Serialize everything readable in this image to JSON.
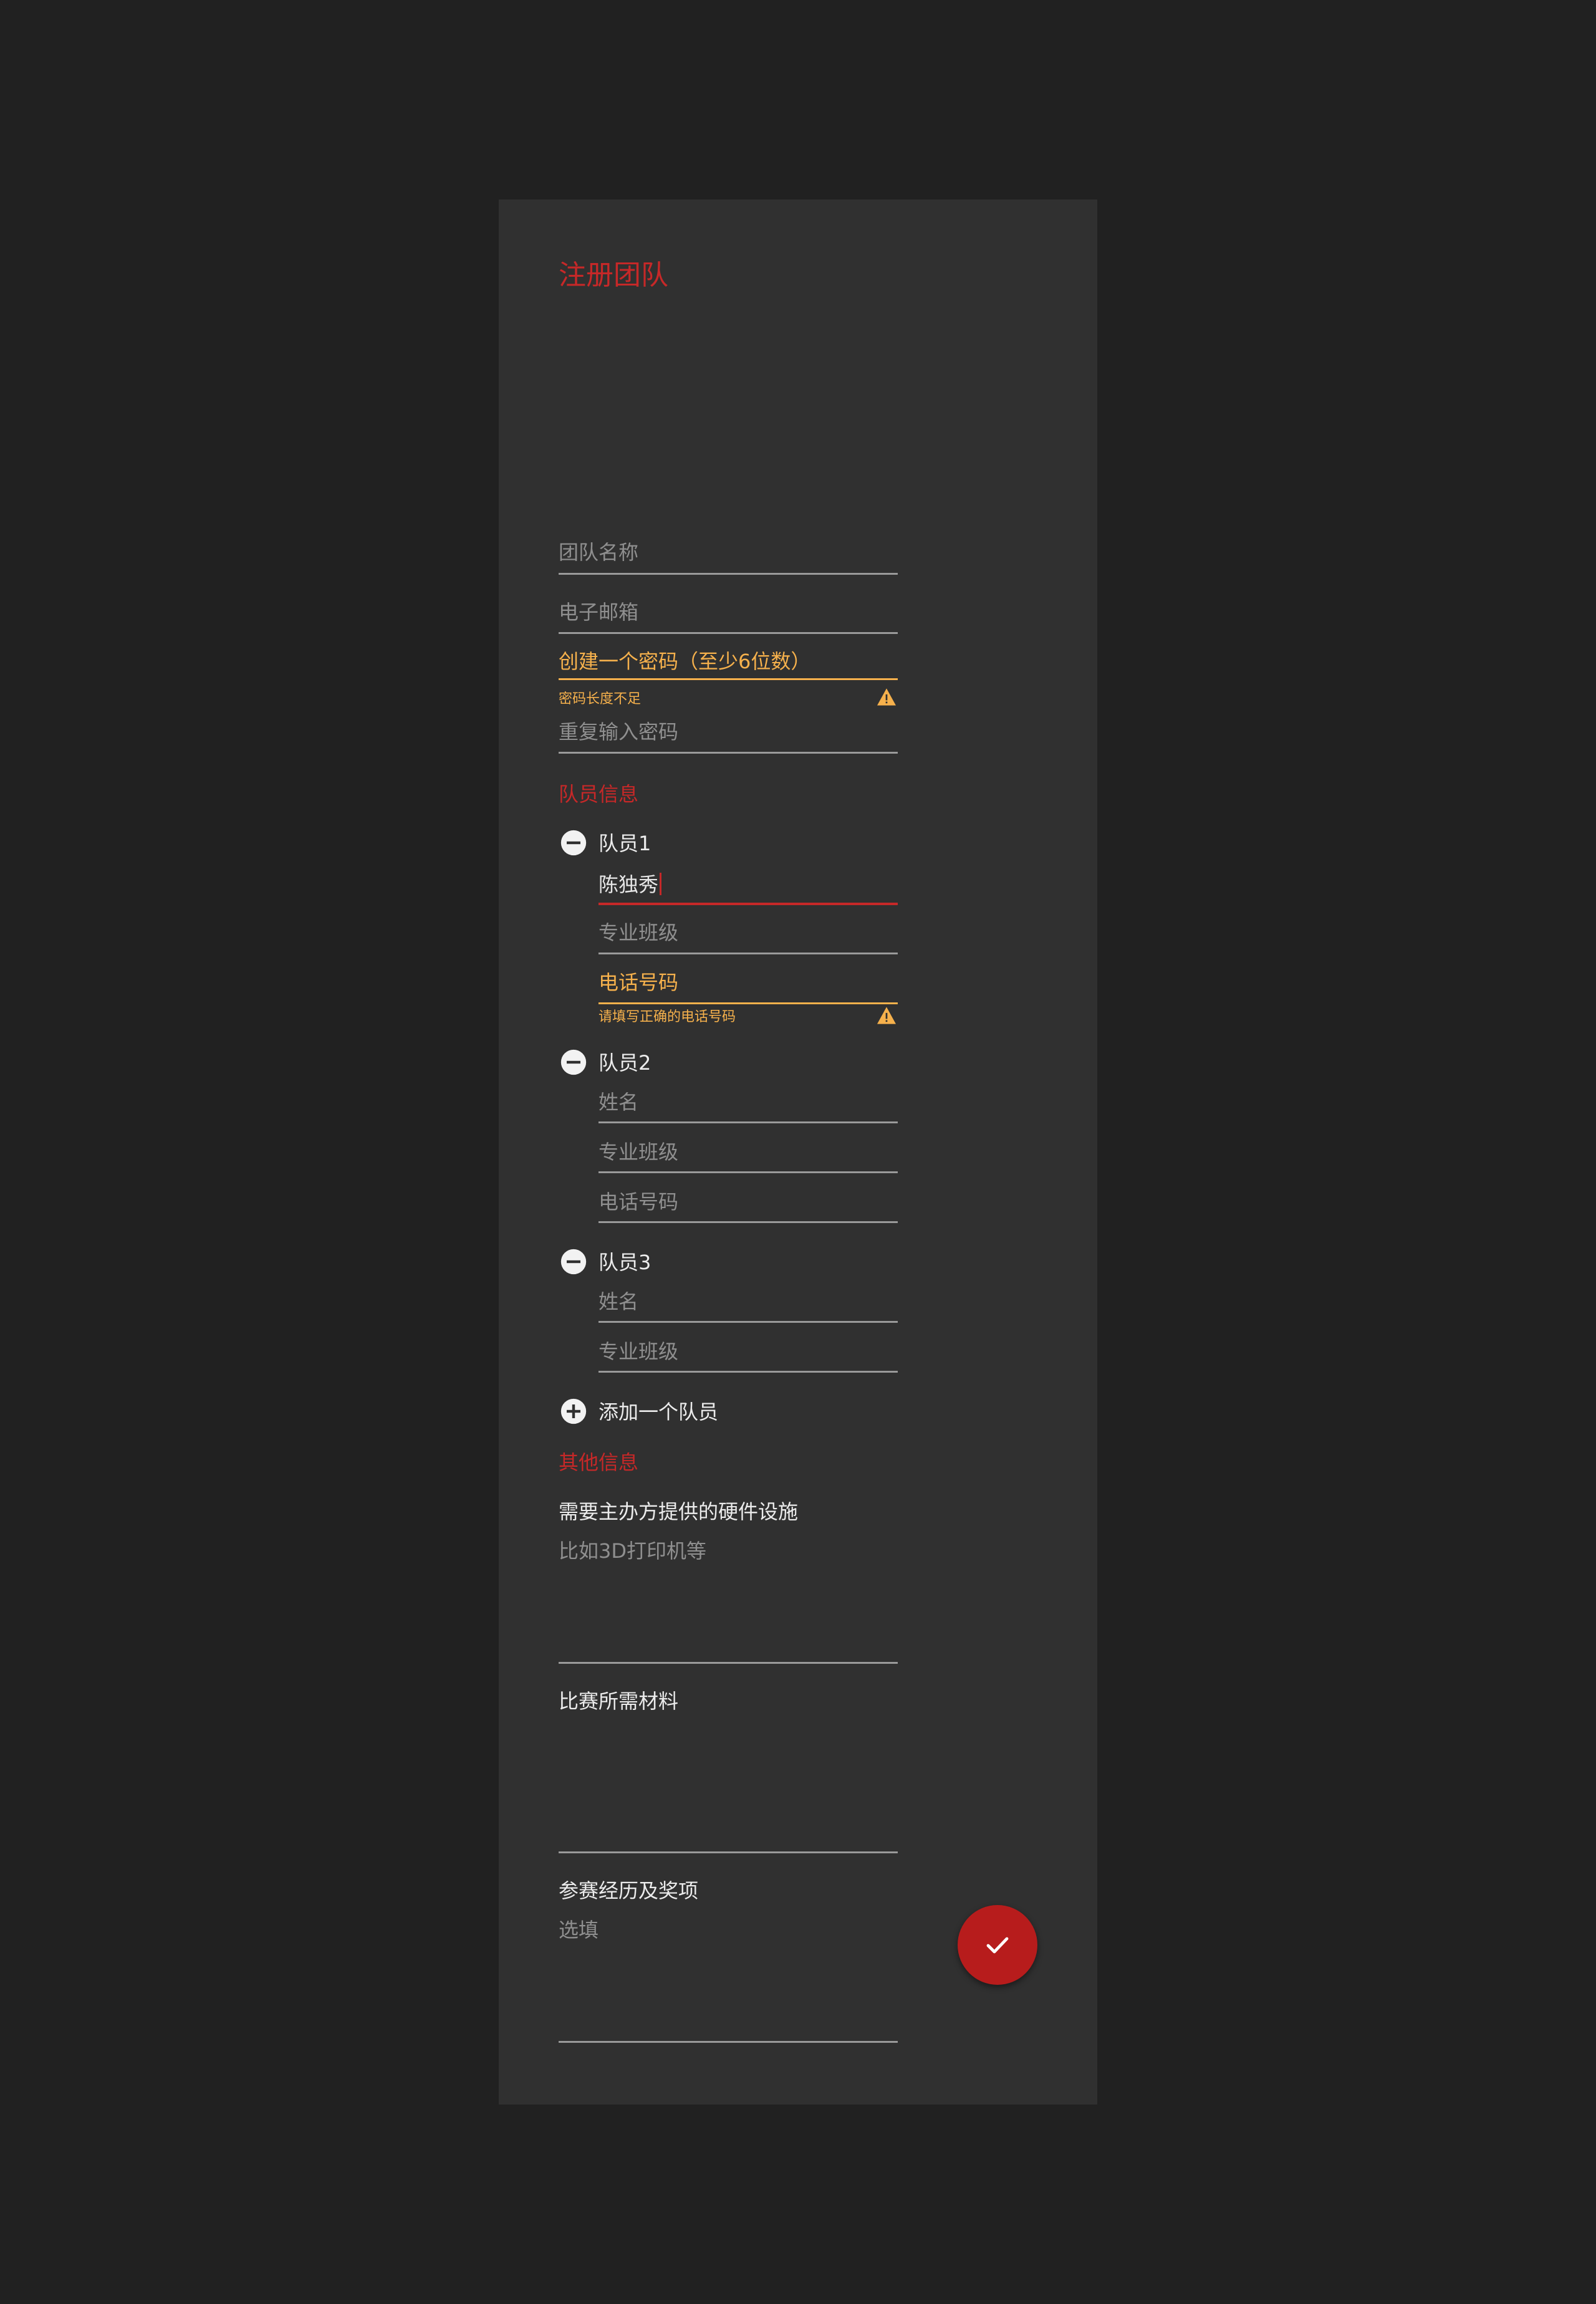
{
  "form": {
    "title": "注册团队",
    "team_name_placeholder": "团队名称",
    "email_placeholder": "电子邮箱",
    "password_label": "创建一个密码（至少6位数）",
    "password_error": "密码长度不足",
    "repeat_password_placeholder": "重复输入密码"
  },
  "members_section": {
    "title": "队员信息",
    "members": [
      {
        "label": "队员1",
        "name_value": "陈独秀",
        "major_placeholder": "专业班级",
        "phone_label": "电话号码",
        "phone_error": "请填写正确的电话号码"
      },
      {
        "label": "队员2",
        "name_placeholder": "姓名",
        "major_placeholder": "专业班级",
        "phone_placeholder": "电话号码"
      },
      {
        "label": "队员3",
        "name_placeholder": "姓名",
        "major_placeholder": "专业班级"
      }
    ],
    "add_member_label": "添加一个队员"
  },
  "other_section": {
    "title": "其他信息",
    "hardware_label": "需要主办方提供的硬件设施",
    "hardware_placeholder": "比如3D打印机等",
    "materials_label": "比赛所需材料",
    "experience_label": "参赛经历及奖项",
    "experience_placeholder": "选填"
  },
  "colors": {
    "background": "#212121",
    "card": "#303030",
    "accent": "#c62828",
    "error": "#f6b14c",
    "submit": "#b71c1c"
  },
  "icons": {
    "remove_member": "minus-circle-icon",
    "add_member": "plus-circle-icon",
    "warning": "warning-icon",
    "submit": "check-icon"
  }
}
